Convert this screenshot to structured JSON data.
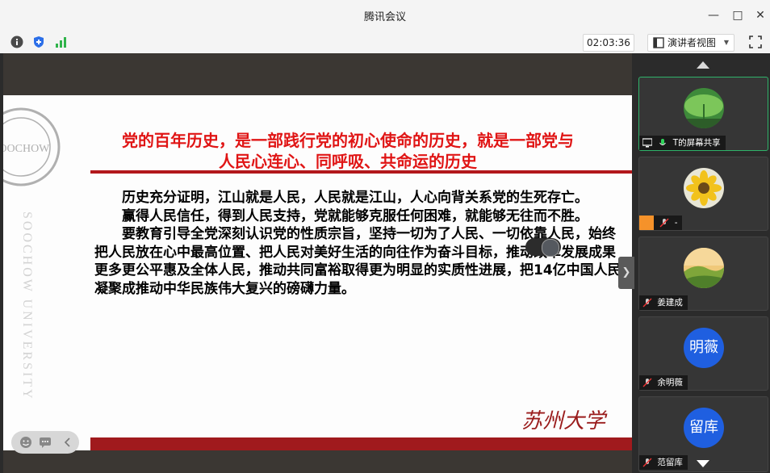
{
  "window": {
    "title": "腾讯会议"
  },
  "toolbar": {
    "timer": "02:03:36",
    "view_mode": "演讲者视图",
    "icons": [
      "info-icon",
      "shield-icon",
      "signal-icon",
      "fullscreen-icon"
    ]
  },
  "slide": {
    "title_line1": "党的百年历史，是一部践行党的初心使命的历史，就是一部党与",
    "title_line2": "人民心连心、同呼吸、共命运的历史",
    "paragraphs": [
      "历史充分证明，江山就是人民，人民就是江山，人心向背关系党的生死存亡。",
      "赢得人民信任，得到人民支持，党就能够克服任何困难，就能够无往而不胜。",
      "要教育引导全党深刻认识党的性质宗旨，坚持一切为了人民、一切依靠人民，始终把人民放在心中最高位置、把人民对美好生活的向往作为奋斗目标，推动改革发展成果更多更公平惠及全体人民，推动共同富裕取得更为明显的实质性进展，把14亿中国人民凝聚成推动中华民族伟大复兴的磅礴力量。"
    ],
    "watermark": "SOOCHOW UNIVERSITY",
    "seal_text": "SOOCHOW",
    "signature": "苏州大学"
  },
  "participants": [
    {
      "name": "T的屏幕共享",
      "avatar": "leaf-photo",
      "active": true,
      "mic": "on"
    },
    {
      "name": "-",
      "avatar": "sunflower-photo",
      "active": false,
      "mic": "muted"
    },
    {
      "name": "姜建成",
      "avatar": "hills-photo",
      "active": false,
      "mic": "muted"
    },
    {
      "name": "余明薇",
      "avatar_text": "明薇",
      "active": false,
      "mic": "muted"
    },
    {
      "name": "范留库",
      "avatar_text": "留库",
      "active": false,
      "mic": "muted"
    }
  ],
  "colors": {
    "accent_red": "#e01515",
    "active_border": "#2fb36a",
    "avatar_blue": "#1f5fe0"
  }
}
